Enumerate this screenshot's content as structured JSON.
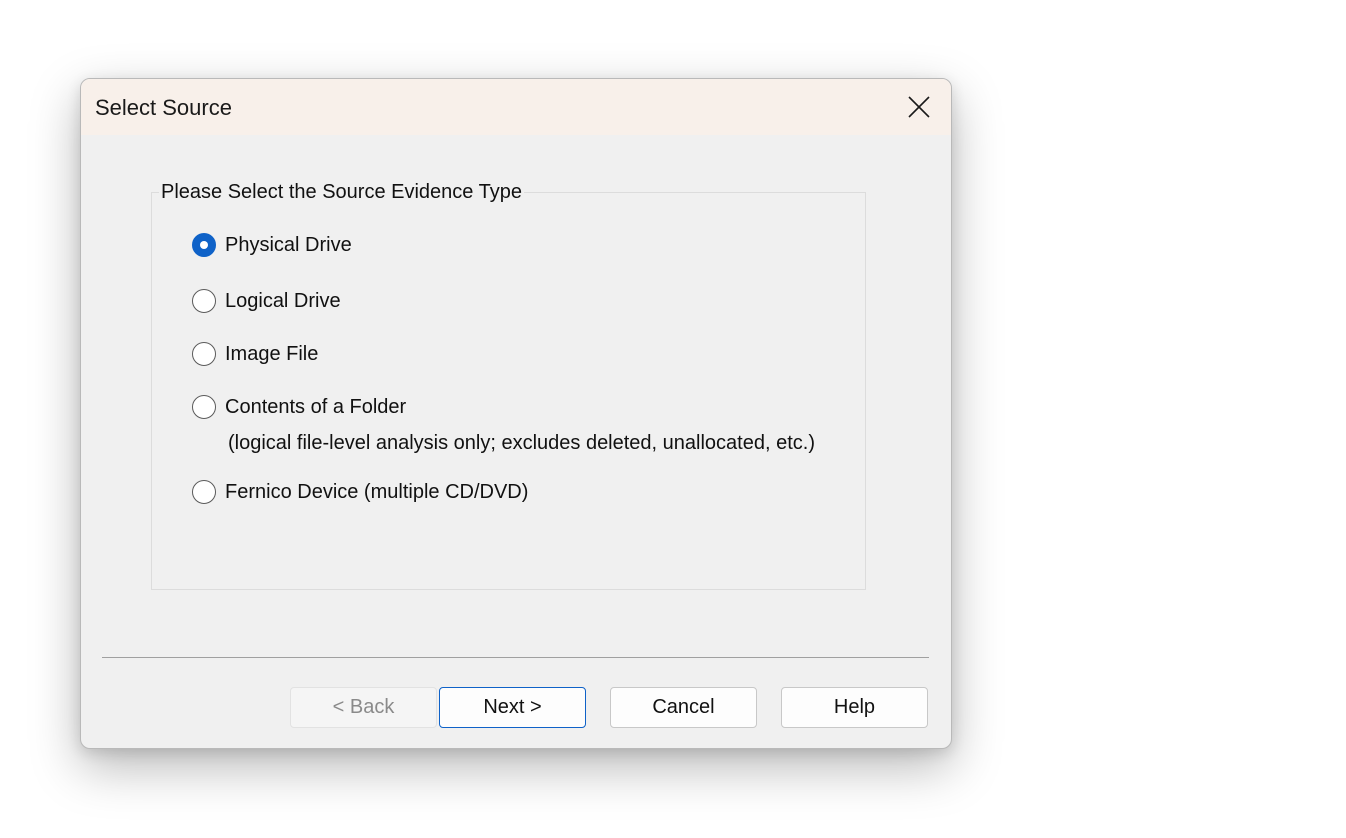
{
  "dialog": {
    "title": "Select Source",
    "close_icon": "close-icon"
  },
  "group": {
    "legend": "Please Select the Source Evidence Type",
    "options": [
      {
        "label": "Physical Drive",
        "checked": true
      },
      {
        "label": "Logical Drive",
        "checked": false
      },
      {
        "label": "Image File",
        "checked": false
      },
      {
        "label": "Contents of a Folder",
        "checked": false
      },
      {
        "label": "Fernico Device (multiple CD/DVD)",
        "checked": false
      }
    ],
    "folder_note": "(logical file-level analysis only; excludes deleted, unallocated, etc.)"
  },
  "buttons": {
    "back": "< Back",
    "next": "Next >",
    "cancel": "Cancel",
    "help": "Help"
  },
  "colors": {
    "accent": "#0f62c8",
    "titlebar": "#f8f0ea",
    "dialog_bg": "#f0f0f0"
  }
}
